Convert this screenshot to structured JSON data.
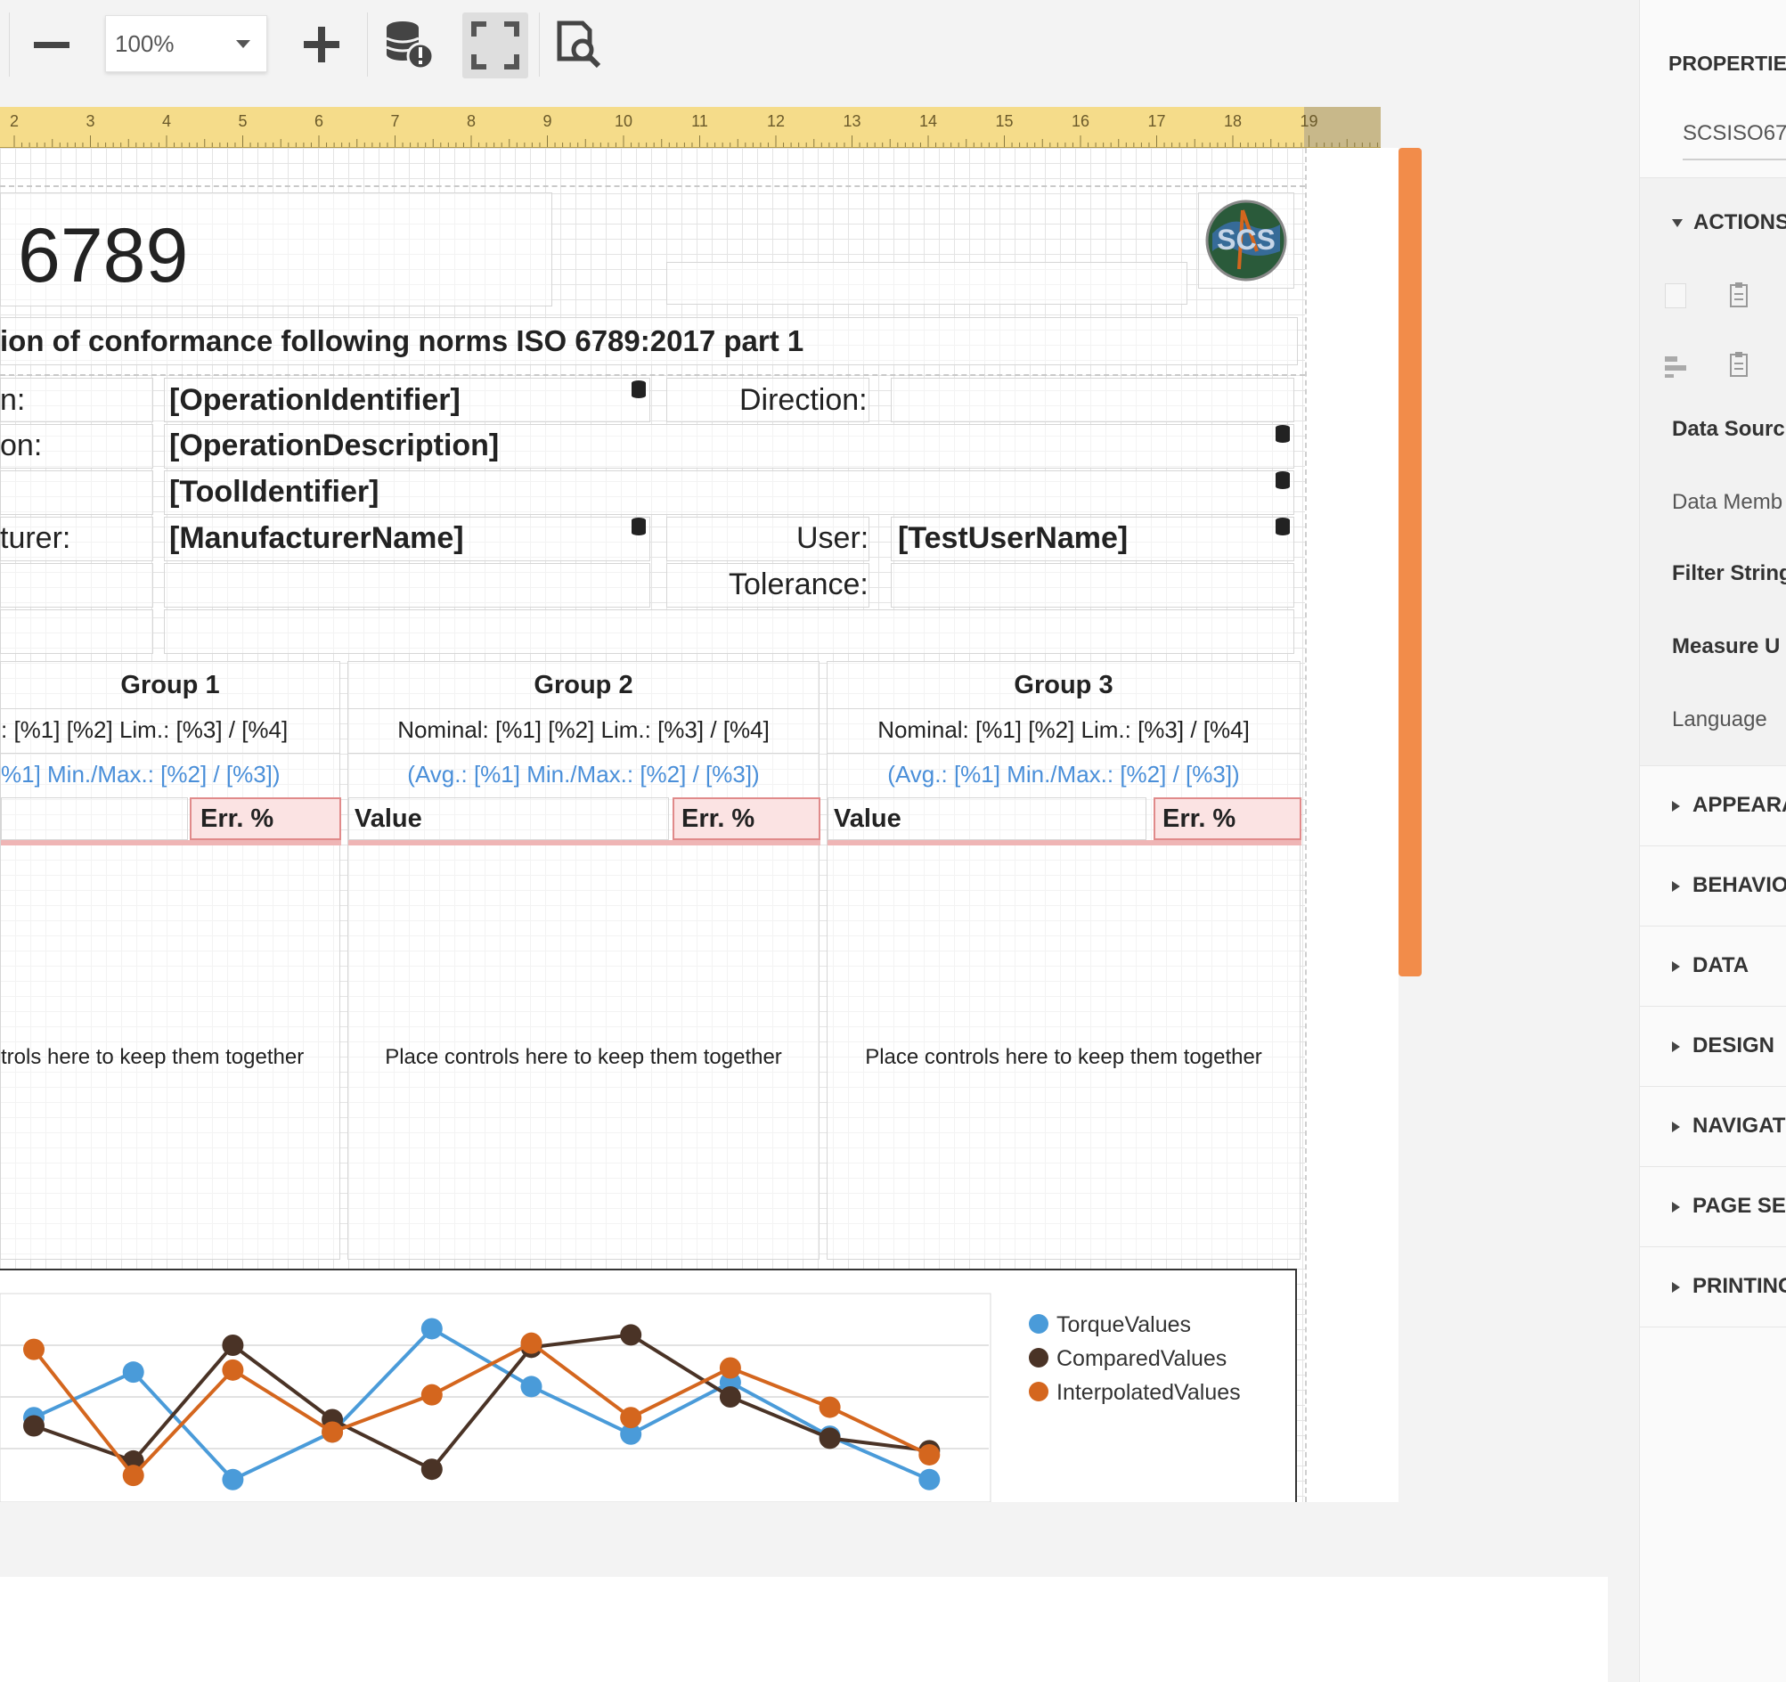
{
  "toolbar": {
    "zoom_value": "100%",
    "icons": [
      "minus-icon",
      "plus-icon",
      "database-warning-icon",
      "fullscreen-icon",
      "preview-search-icon"
    ]
  },
  "ruler": {
    "numbers": [
      "2",
      "3",
      "4",
      "5",
      "6",
      "7",
      "8",
      "9",
      "10",
      "11",
      "12",
      "13",
      "14",
      "15",
      "16",
      "17",
      "18",
      "19"
    ]
  },
  "report": {
    "title_number": "6789",
    "subtitle": "ion of conformance following norms ISO 6789:2017 part 1",
    "labels": {
      "row1": "n:",
      "row2": "on:",
      "row4": "turer:",
      "direction": "Direction:",
      "user": "User:",
      "tolerance": "Tolerance:"
    },
    "fields": {
      "operation_identifier": "[OperationIdentifier]",
      "operation_description": "[OperationDescription]",
      "tool_identifier": "[ToolIdentifier]",
      "manufacturer_name": "[ManufacturerName]",
      "test_user_name": "[TestUserName]"
    },
    "logo_text": "SCS",
    "groups": [
      {
        "title": "Group 1",
        "nominal": ": [%1] [%2] Lim.: [%3] / [%4]",
        "avg": "%1] Min./Max.: [%2] / [%3])",
        "value_label": "",
        "err_label": "Err. %",
        "placeholder": "trols here to keep them together"
      },
      {
        "title": "Group 2",
        "nominal": "Nominal: [%1] [%2] Lim.: [%3] / [%4]",
        "avg": "(Avg.: [%1] Min./Max.: [%2] / [%3])",
        "value_label": "Value",
        "err_label": "Err. %",
        "placeholder": "Place controls here to keep them together"
      },
      {
        "title": "Group 3",
        "nominal": "Nominal: [%1] [%2] Lim.: [%3] / [%4]",
        "avg": "(Avg.: [%1] Min./Max.: [%2] / [%3])",
        "value_label": "Value",
        "err_label": "Err. %",
        "placeholder": "Place controls here to keep them together"
      }
    ]
  },
  "chart_data": {
    "type": "line",
    "title": "",
    "xlabel": "",
    "ylabel": "",
    "legend_position": "right",
    "grid": true,
    "ylim": [
      0,
      10
    ],
    "x": [
      0,
      1,
      2,
      3,
      4,
      5,
      6,
      7,
      8,
      9
    ],
    "series": [
      {
        "name": "TorqueValues",
        "color": "#4a9bd9",
        "values": [
          4.0,
          6.2,
          1.0,
          3.3,
          8.3,
          5.5,
          3.2,
          5.7,
          3.1,
          1.0
        ]
      },
      {
        "name": "ComparedValues",
        "color": "#4a3326",
        "values": [
          3.6,
          1.9,
          7.5,
          3.9,
          1.5,
          7.4,
          8.0,
          5.0,
          3.0,
          2.4
        ]
      },
      {
        "name": "InterpolatedValues",
        "color": "#d4661e",
        "values": [
          7.3,
          1.2,
          6.3,
          3.3,
          5.1,
          7.6,
          4.0,
          6.4,
          4.5,
          2.2
        ]
      }
    ]
  },
  "properties": {
    "header": "PROPERTIE",
    "report_name": "SCSISO67",
    "actions_label": "ACTIONS",
    "rows": [
      "Data Sourc",
      "Data Memb",
      "Filter String",
      "Measure U",
      "Language"
    ],
    "sections": [
      "APPEARA",
      "BEHAVIO",
      "DATA",
      "DESIGN",
      "NAVIGATI",
      "PAGE SE",
      "PRINTING"
    ]
  },
  "colors": {
    "ruler": "#f5dc8a",
    "scrollbar": "#f28c4a",
    "err_header_bg": "#fbe3e3",
    "err_header_border": "#e08a8a",
    "avg_text": "#4a8fd9"
  }
}
